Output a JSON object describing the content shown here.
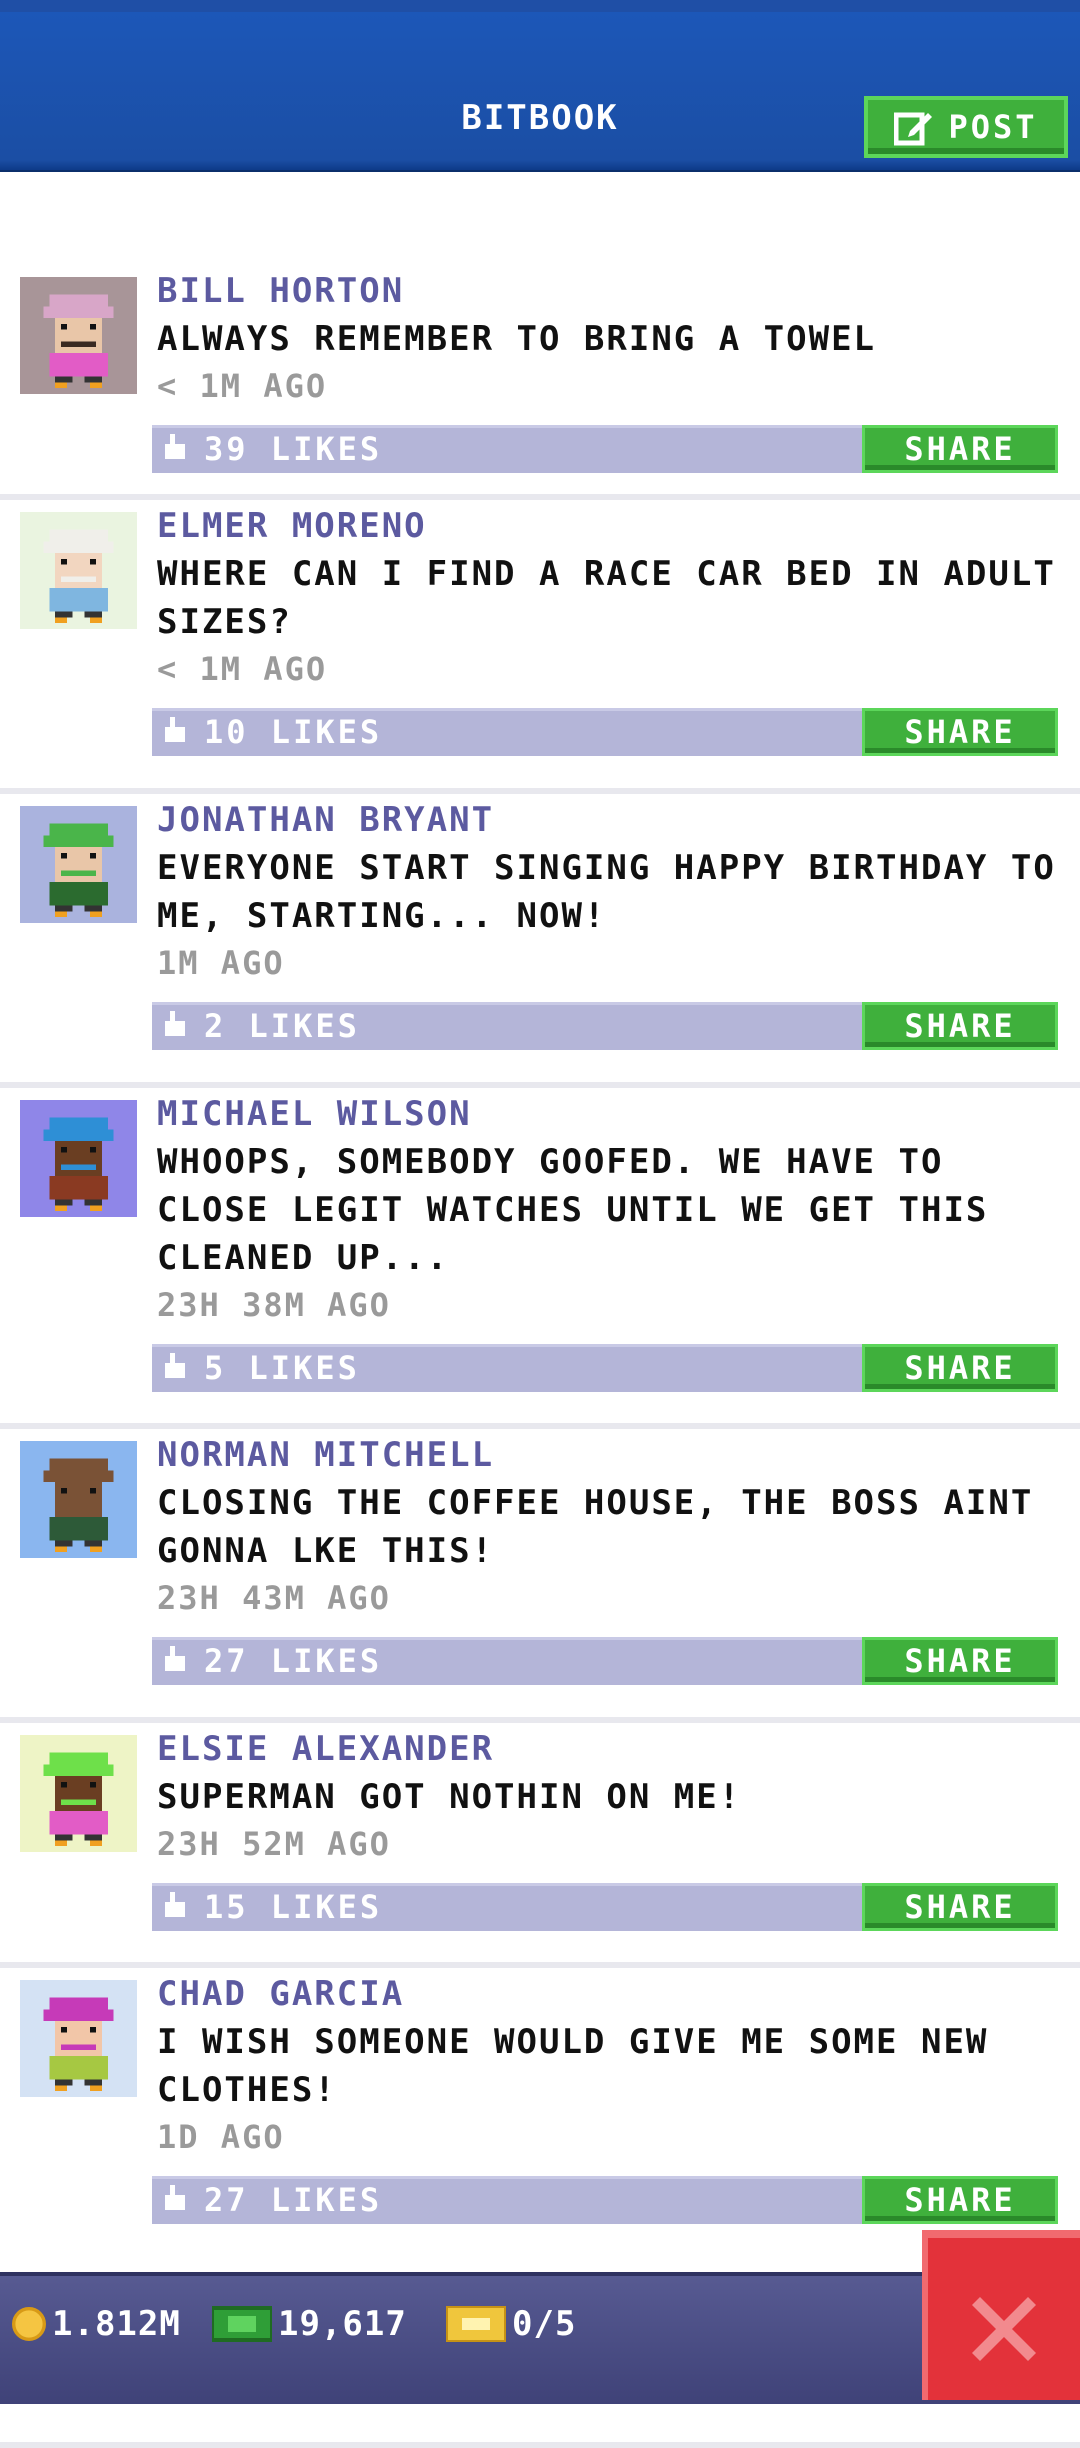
{
  "header": {
    "title": "BITBOOK",
    "post_label": "POST"
  },
  "posts": [
    {
      "name": "BILL HORTON",
      "message": "ALWAYS REMEMBER TO BRING A TOWEL",
      "time": "< 1M AGO",
      "likes": "39 LIKES",
      "share": "SHARE",
      "avatar_bg": "#a89598",
      "hat": "#d8a6c8",
      "shirt": "#e25cc6",
      "skin": "#e9c6a8",
      "hair": "#3a2a22"
    },
    {
      "name": "ELMER MORENO",
      "message": "WHERE CAN I FIND A RACE CAR BED IN ADULT SIZES?",
      "time": "< 1M AGO",
      "likes": "10 LIKES",
      "share": "SHARE",
      "avatar_bg": "#eaf4e0",
      "hat": "#f0efea",
      "shirt": "#7fb6e0",
      "skin": "#f2d6c0",
      "hair": "#f0efea"
    },
    {
      "name": "JONATHAN BRYANT",
      "message": "EVERYONE START SINGING HAPPY BIRTHDAY TO ME, STARTING... NOW!",
      "time": "1M AGO",
      "likes": "2 LIKES",
      "share": "SHARE",
      "avatar_bg": "#aab3de",
      "hat": "#4ab54a",
      "shirt": "#2b6b2f",
      "skin": "#e9c6a8",
      "hair": "#4ab54a"
    },
    {
      "name": "MICHAEL WILSON",
      "message": "WHOOPS, SOMEBODY GOOFED. WE HAVE TO CLOSE LEGIT WATCHES UNTIL WE GET THIS CLEANED UP...",
      "time": "23H 38M AGO",
      "likes": "5 LIKES",
      "share": "SHARE",
      "avatar_bg": "#8f86e8",
      "hat": "#2e8fd6",
      "shirt": "#8a3a22",
      "skin": "#6a3e22",
      "hair": "#2e8fd6"
    },
    {
      "name": "NORMAN MITCHELL",
      "message": "CLOSING THE COFFEE HOUSE, THE BOSS AINT GONNA LKE THIS!",
      "time": "23H 43M AGO",
      "likes": "27 LIKES",
      "share": "SHARE",
      "avatar_bg": "#8ab6ef",
      "hat": "#7a5236",
      "shirt": "#2d5a38",
      "skin": "#7a5236",
      "hair": "#7a5236"
    },
    {
      "name": "ELSIE ALEXANDER",
      "message": "SUPERMAN GOT NOTHIN ON ME!",
      "time": "23H 52M AGO",
      "likes": "15 LIKES",
      "share": "SHARE",
      "avatar_bg": "#eef4c6",
      "hat": "#6ee04a",
      "shirt": "#e25cc6",
      "skin": "#6a3e22",
      "hair": "#6ee04a"
    },
    {
      "name": "CHAD GARCIA",
      "message": "I WISH SOMEONE WOULD GIVE ME SOME NEW CLOTHES!",
      "time": "1D AGO",
      "likes": "27 LIKES",
      "share": "SHARE",
      "avatar_bg": "#d4e2f4",
      "hat": "#c63ab8",
      "shirt": "#a6c842",
      "skin": "#f2c6a8",
      "hair": "#c63ab8"
    }
  ],
  "footer": {
    "coins": "1.812M",
    "cash": "19,617",
    "tickets": "0/5"
  },
  "colors": {
    "accent_green": "#3fb03c",
    "header_blue": "#1b4ea4",
    "close_red": "#e3323a"
  }
}
